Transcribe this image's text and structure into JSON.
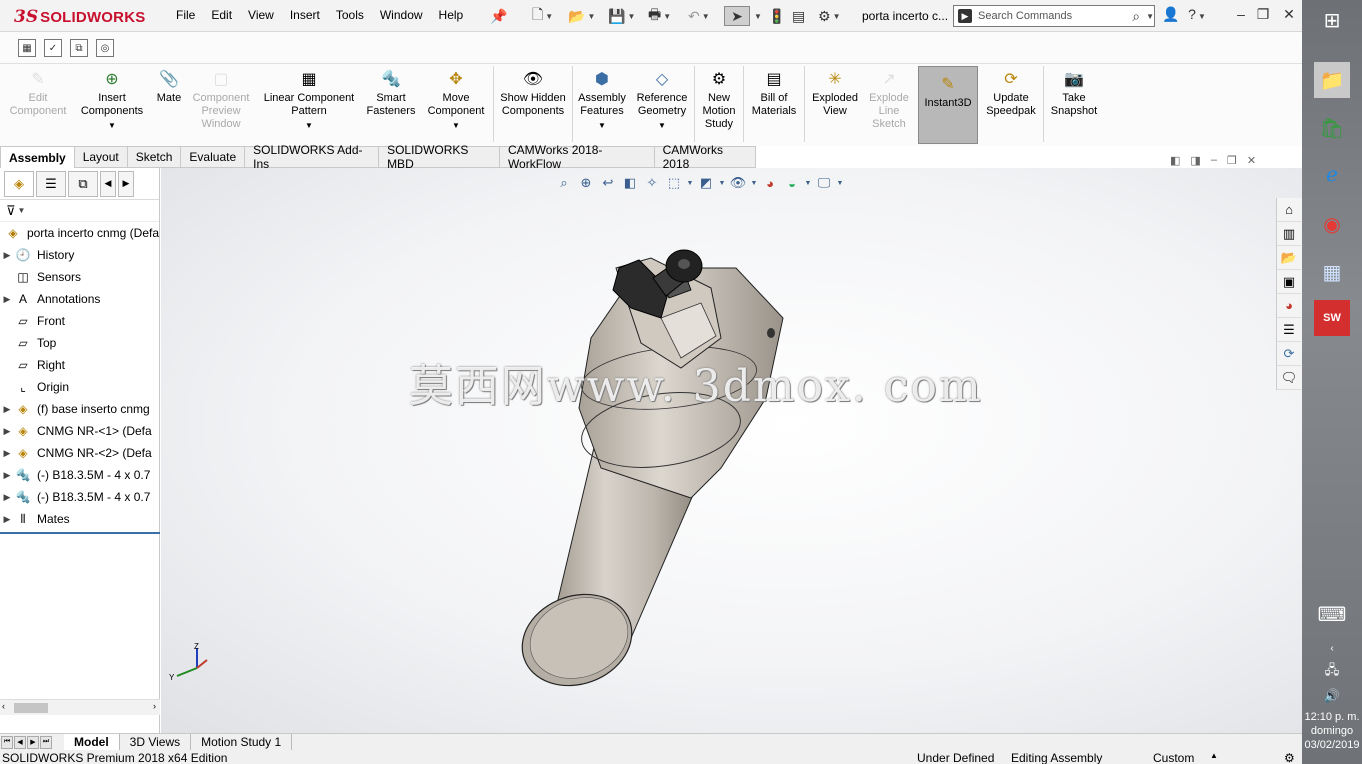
{
  "app": {
    "logo_mark": "3S",
    "brand": "SOLIDWORKS",
    "menu": [
      "File",
      "Edit",
      "View",
      "Insert",
      "Tools",
      "Window",
      "Help"
    ],
    "doc_title": "porta incerto c...",
    "search_placeholder": "Search Commands"
  },
  "commands": [
    {
      "label": "Edit Component",
      "disabled": true
    },
    {
      "label": "Insert Components",
      "disabled": false
    },
    {
      "label": "Mate",
      "disabled": false
    },
    {
      "label": "Component Preview Window",
      "disabled": true
    },
    {
      "label": "Linear Component Pattern",
      "disabled": false
    },
    {
      "label": "Smart Fasteners",
      "disabled": false
    },
    {
      "label": "Move Component",
      "disabled": false
    },
    {
      "label": "Show Hidden Components",
      "disabled": false
    },
    {
      "label": "Assembly Features",
      "disabled": false
    },
    {
      "label": "Reference Geometry",
      "disabled": false
    },
    {
      "label": "New Motion Study",
      "disabled": false
    },
    {
      "label": "Bill of Materials",
      "disabled": false
    },
    {
      "label": "Exploded View",
      "disabled": false
    },
    {
      "label": "Explode Line Sketch",
      "disabled": true
    },
    {
      "label": "Instant3D",
      "disabled": false,
      "active": true
    },
    {
      "label": "Update Speedpak",
      "disabled": false
    },
    {
      "label": "Take Snapshot",
      "disabled": false
    }
  ],
  "tabs": [
    "Assembly",
    "Layout",
    "Sketch",
    "Evaluate",
    "SOLIDWORKS Add-Ins",
    "SOLIDWORKS MBD",
    "CAMWorks 2018-WorkFlow",
    "CAMWorks 2018"
  ],
  "tree": {
    "root": "porta incerto cnmg  (Defa",
    "items": [
      {
        "label": "History",
        "expandable": true,
        "icon": "history-icon"
      },
      {
        "label": "Sensors",
        "expandable": false,
        "icon": "sensor-icon"
      },
      {
        "label": "Annotations",
        "expandable": true,
        "icon": "annotation-icon"
      },
      {
        "label": "Front",
        "expandable": false,
        "icon": "plane-icon"
      },
      {
        "label": "Top",
        "expandable": false,
        "icon": "plane-icon"
      },
      {
        "label": "Right",
        "expandable": false,
        "icon": "plane-icon"
      },
      {
        "label": "Origin",
        "expandable": false,
        "icon": "origin-icon"
      },
      {
        "label": "(f) base inserto cnmg",
        "expandable": true,
        "icon": "part-icon"
      },
      {
        "label": "CNMG NR-<1> (Defa",
        "expandable": true,
        "icon": "part-icon"
      },
      {
        "label": "CNMG NR-<2> (Defa",
        "expandable": true,
        "icon": "part-icon"
      },
      {
        "label": "(-) B18.3.5M - 4 x 0.7",
        "expandable": true,
        "icon": "screw-icon"
      },
      {
        "label": "(-) B18.3.5M - 4 x 0.7",
        "expandable": true,
        "icon": "screw-icon"
      },
      {
        "label": "Mates",
        "expandable": true,
        "icon": "mates-icon"
      }
    ]
  },
  "watermark": "莫西网www. 3dmox. com",
  "bottom_tabs": [
    "Model",
    "3D Views",
    "Motion Study 1"
  ],
  "status": {
    "edition": "SOLIDWORKS Premium 2018 x64 Edition",
    "defined": "Under Defined",
    "mode": "Editing Assembly",
    "units": "Custom"
  },
  "clock": {
    "time": "12:10 p. m.",
    "day": "domingo",
    "date": "03/02/2019"
  },
  "colors": {
    "accent": "#c8102e",
    "part": "#c9c4bb"
  }
}
